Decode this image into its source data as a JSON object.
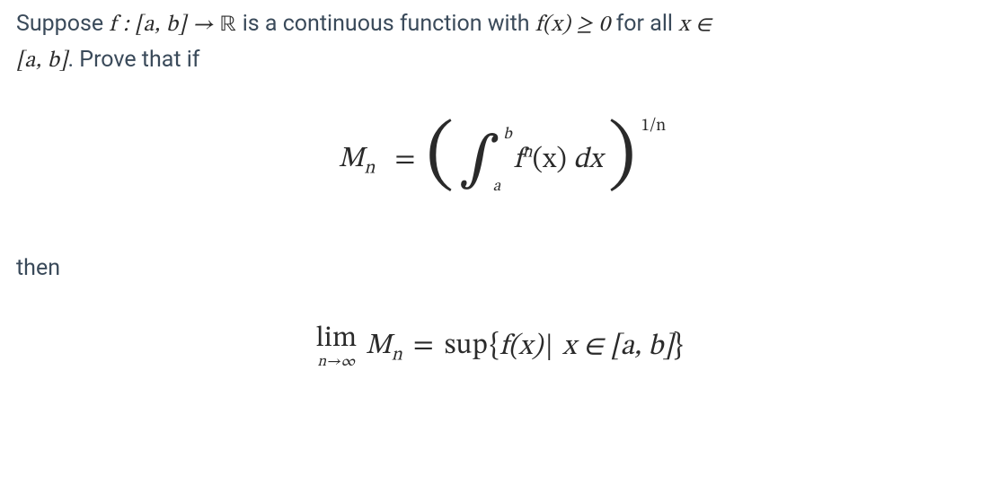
{
  "para1_part1": "Suppose ",
  "para1_math1": "f : [a, b] → ",
  "para1_math1_R": "ℝ",
  "para1_part2": " is a continuous function with ",
  "para1_math2": "f(x) ≥ 0",
  "para1_part3": " for all ",
  "para1_math3": "x ∈",
  "para1_math4": "[a, b]",
  "para1_part4": ". Prove that if",
  "eq1": {
    "lhs_M": "M",
    "lhs_n": "n",
    "equals": "=",
    "lparen": "(",
    "int_sign": "∫",
    "upper": "b",
    "lower": "a",
    "integrand_f": "f",
    "integrand_exp": "n",
    "integrand_arg": "(x)",
    "dx": " dx",
    "rparen": ")",
    "outer_exp": "1/n"
  },
  "then": "then",
  "eq2": {
    "lim": "lim",
    "limsub": "n→∞",
    "M": "M",
    "n": "n",
    "equals": "=",
    "sup": "sup",
    "lbrace": "{",
    "fx": "f(x)",
    "bar": "|",
    "xin": " x ∈ [a, b]",
    "rbrace": "}"
  }
}
